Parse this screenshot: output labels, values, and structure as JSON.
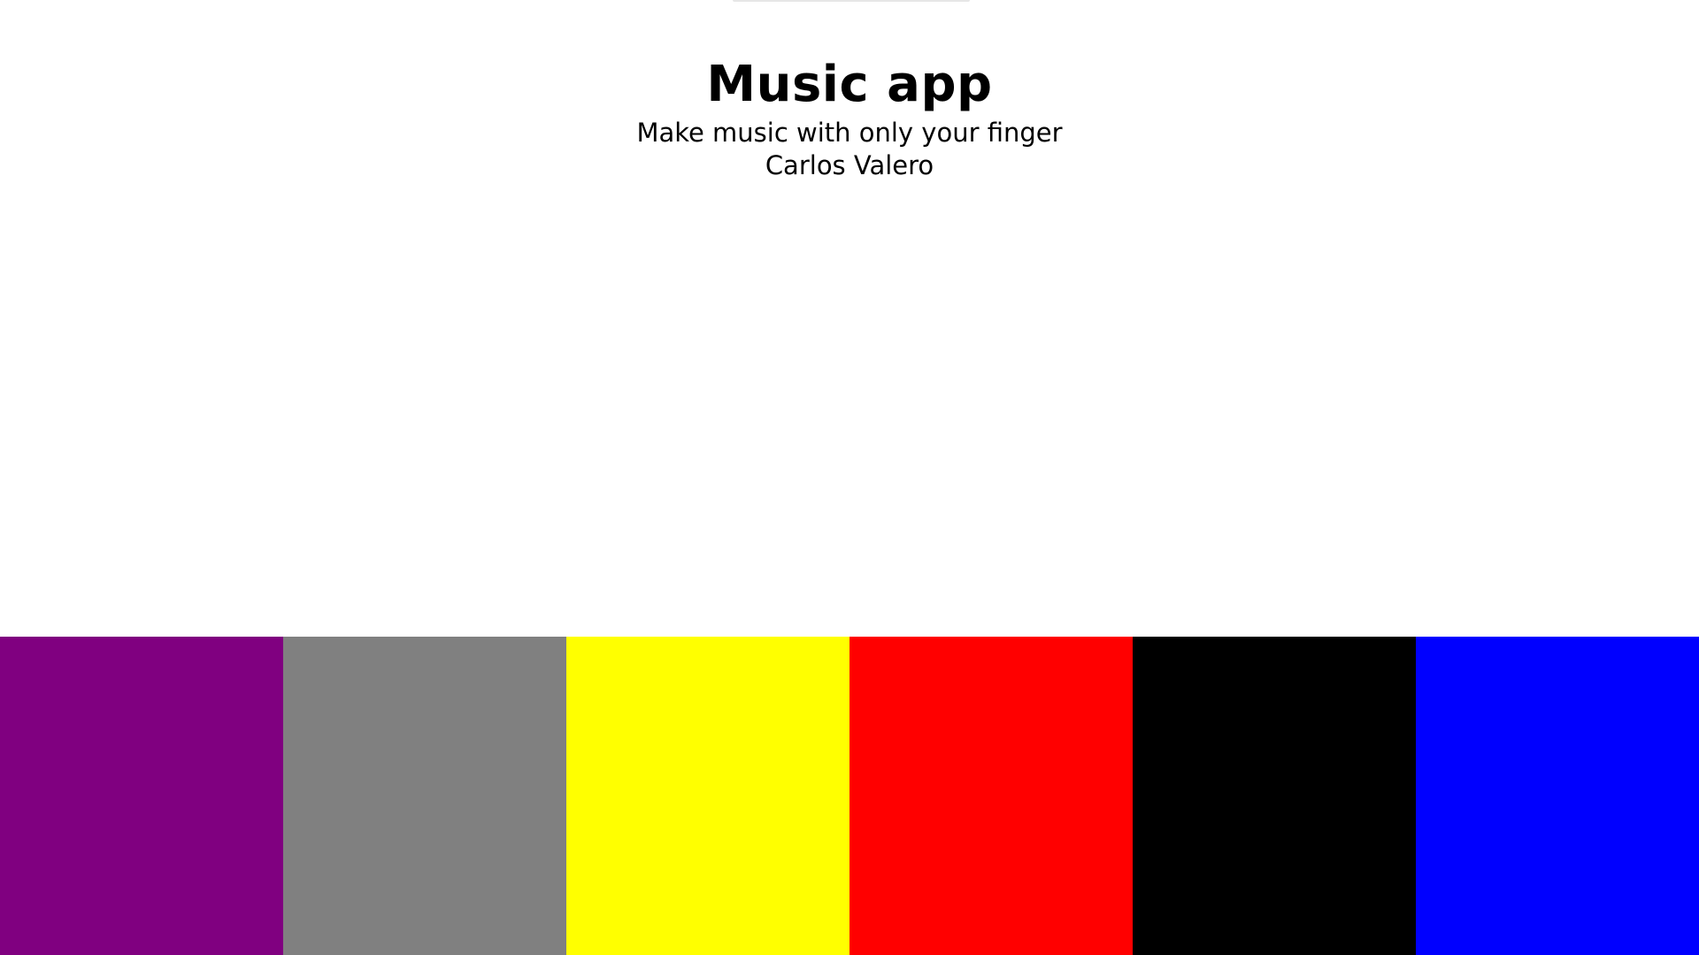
{
  "header": {
    "title": "Music app",
    "subtitle": "Make music with only your finger",
    "author": "Carlos Valero"
  },
  "pads": [
    {
      "name": "pad-purple",
      "color": "#800080"
    },
    {
      "name": "pad-gray",
      "color": "#808080"
    },
    {
      "name": "pad-yellow",
      "color": "#ffff00"
    },
    {
      "name": "pad-red",
      "color": "#ff0000"
    },
    {
      "name": "pad-black",
      "color": "#000000"
    },
    {
      "name": "pad-blue",
      "color": "#0000ff"
    }
  ]
}
